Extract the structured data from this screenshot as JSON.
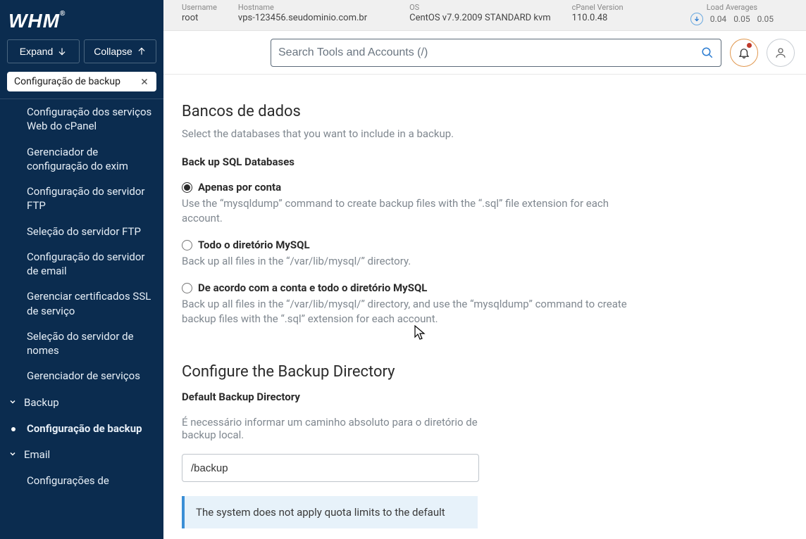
{
  "sidebar": {
    "logo": "WHM",
    "expand": "Expand",
    "collapse": "Collapse",
    "tag": "Configuração de backup",
    "items": [
      "Configuração dos serviços Web do cPanel",
      "Gerenciador de configuração do exim",
      "Configuração do servidor FTP",
      "Seleção do servidor FTP",
      "Configuração do servidor de email",
      "Gerenciar certificados SSL de serviço",
      "Seleção do servidor de nomes",
      "Gerenciador de serviços"
    ],
    "cat_backup": "Backup",
    "sub_backup": "Configuração de backup",
    "cat_email": "Email",
    "sub_email": "Configurações de"
  },
  "top": {
    "user_lbl": "Username",
    "user_val": "root",
    "host_lbl": "Hostname",
    "host_val": "vps-123456.seudominio.com.br",
    "os_lbl": "OS",
    "os_val": "CentOS v7.9.2009 STANDARD kvm",
    "cp_lbl": "cPanel Version",
    "cp_val": "110.0.48",
    "load_lbl": "Load Averages",
    "load_1": "0.04",
    "load_2": "0.05",
    "load_3": "0.05"
  },
  "search": {
    "placeholder": "Search Tools and Accounts (/)"
  },
  "main": {
    "db_heading": "Bancos de dados",
    "db_desc": "Select the databases that you want to include in a backup.",
    "db_sub": "Back up SQL Databases",
    "opt1_label": "Apenas por conta",
    "opt1_desc": "Use the “mysqldump” command to create backup files with the “.sql” file extension for each account.",
    "opt2_label": "Todo o diretório MySQL",
    "opt2_desc": "Back up all files in the “/var/lib/mysql/” directory.",
    "opt3_label": "De acordo com a conta e todo o diretório MySQL",
    "opt3_desc": "Back up all files in the “/var/lib/mysql/” directory, and use the “mysqldump” command to create backup files with the “.sql” extension for each account.",
    "dir_heading": "Configure the Backup Directory",
    "dir_sub": "Default Backup Directory",
    "dir_desc": "É necessário informar um caminho absoluto para o diretório de backup local.",
    "dir_value": "/backup",
    "info": "The system does not apply quota limits to the default"
  }
}
